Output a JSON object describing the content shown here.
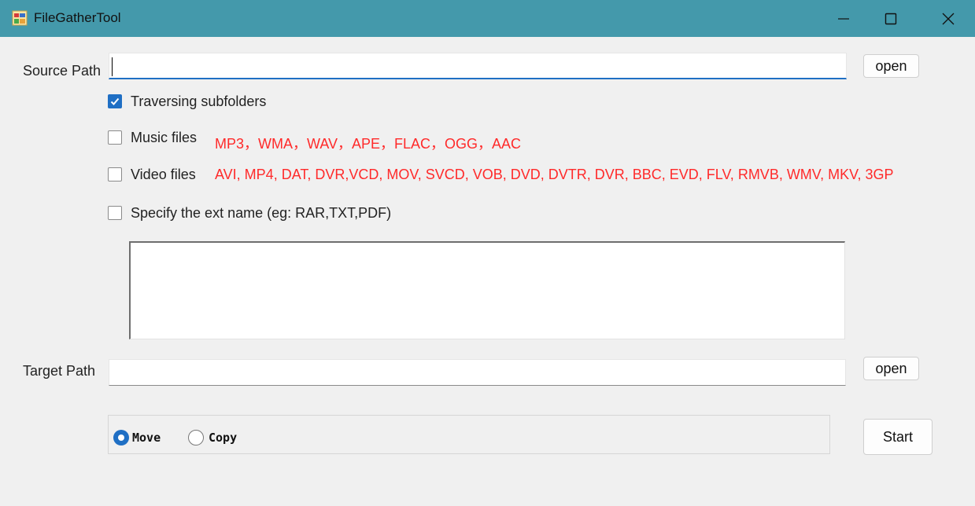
{
  "window": {
    "title": "FileGatherTool",
    "icons": {
      "app": "app-icon",
      "minimize": "minimize-icon",
      "maximize": "maximize-icon",
      "close": "close-icon"
    }
  },
  "source": {
    "label": "Source Path",
    "value": "",
    "open_label": "open"
  },
  "options": {
    "traverse": {
      "label": "Traversing subfolders",
      "checked": true
    },
    "music": {
      "label": "Music files",
      "checked": false,
      "extensions": "MP3，WMA，WAV，APE，FLAC，OGG，AAC"
    },
    "video": {
      "label": "Video files",
      "checked": false,
      "extensions": "AVI, MP4, DAT, DVR,VCD, MOV, SVCD, VOB, DVD, DVTR, DVR, BBC, EVD, FLV, RMVB, WMV, MKV, 3GP"
    },
    "custom": {
      "label": "Specify the ext name (eg: RAR,TXT,PDF)",
      "checked": false
    },
    "custom_ext_value": ""
  },
  "target": {
    "label": "Target Path",
    "value": "",
    "open_label": "open"
  },
  "mode": {
    "options": [
      "Move",
      "Copy"
    ],
    "selected": "Move"
  },
  "start_label": "Start",
  "colors": {
    "titlebar": "#4499ab",
    "accent": "#1f6fc4",
    "extension_text": "#ff2a2a",
    "background": "#f0f0f0"
  }
}
